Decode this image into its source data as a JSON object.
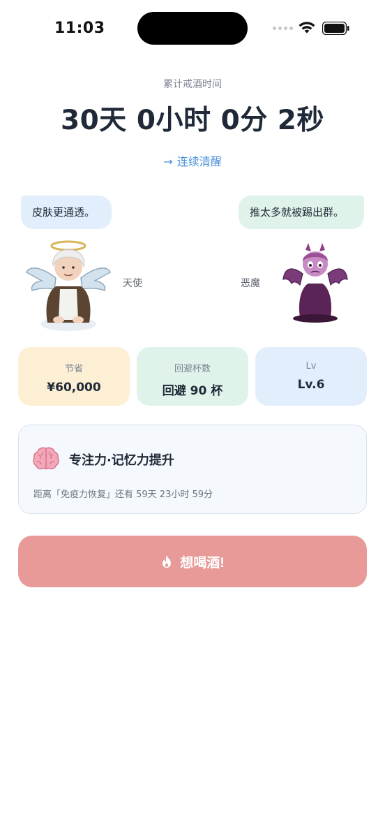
{
  "status_bar": {
    "time": "11:03",
    "icons": [
      "cellular-dots-icon",
      "wifi-icon",
      "battery-icon"
    ]
  },
  "header": {
    "caption": "累计戒酒时间",
    "duration": "30天 0小时 0分 2秒",
    "streak_link_label": "连续清醒",
    "streak_link_icon": "arrow-right-icon"
  },
  "characters": {
    "angel": {
      "speech": "皮肤更通透。",
      "name": "天使",
      "bubble_color": "#e2eefb"
    },
    "devil": {
      "speech": "推太多就被踢出群。",
      "name": "恶魔",
      "bubble_color": "#dff3ea"
    }
  },
  "stats": [
    {
      "label": "节省",
      "value": "¥60,000",
      "color": "#fcefd3"
    },
    {
      "label": "回避杯数",
      "value": "回避 90 杯",
      "color": "#dff3ea"
    },
    {
      "label": "Lv",
      "value": "Lv.6",
      "color": "#e2eefb"
    }
  ],
  "milestone": {
    "icon": "brain-icon",
    "title": "专注力·记忆力提升",
    "subtitle": "距离「免疫力恢复」还有 59天 23小时 59分"
  },
  "craving_button": {
    "label": "想喝酒!",
    "icon": "flame-icon",
    "color": "#e89a99"
  },
  "colors": {
    "accent_blue": "#4a90d9",
    "text_primary": "#1f2937",
    "text_secondary": "#7b8494"
  }
}
